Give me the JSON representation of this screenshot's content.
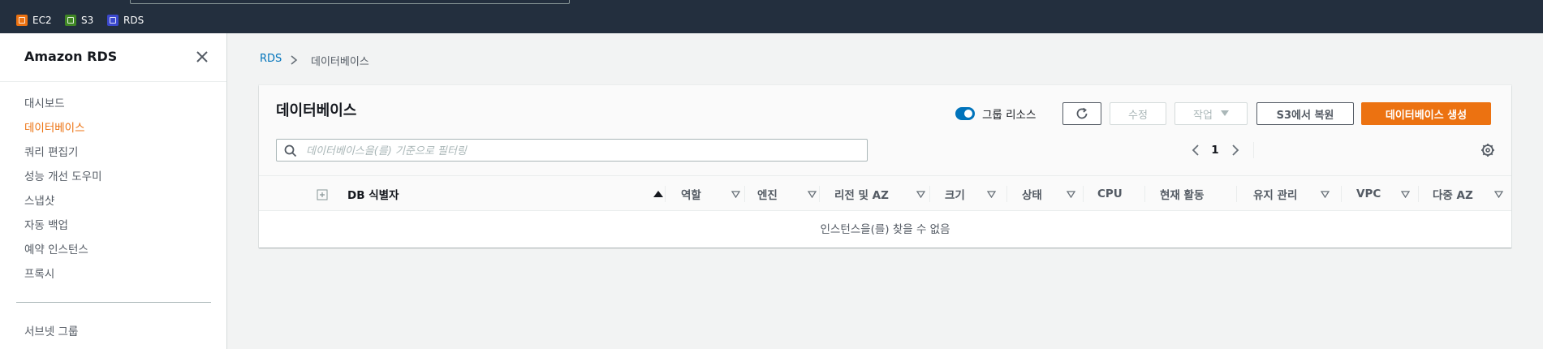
{
  "favorites": [
    {
      "label": "EC2",
      "color": "#ec7211",
      "icon": "ec2-icon"
    },
    {
      "label": "S3",
      "color": "#3f8624",
      "icon": "s3-icon"
    },
    {
      "label": "RDS",
      "color": "#3b48cc",
      "icon": "rds-icon"
    }
  ],
  "sidebar": {
    "title": "Amazon RDS",
    "items": [
      {
        "label": "대시보드"
      },
      {
        "label": "데이터베이스",
        "active": true
      },
      {
        "label": "쿼리 편집기"
      },
      {
        "label": "성능 개선 도우미"
      },
      {
        "label": "스냅샷"
      },
      {
        "label": "자동 백업"
      },
      {
        "label": "예약 인스턴스"
      },
      {
        "label": "프록시"
      }
    ],
    "bottom_items": [
      {
        "label": "서브넷 그룹"
      }
    ]
  },
  "breadcrumb": {
    "root": "RDS",
    "current": "데이터베이스"
  },
  "panel": {
    "title": "데이터베이스",
    "group_toggle_label": "그룹 리소스",
    "group_toggle_on": true,
    "modify_label": "수정",
    "actions_label": "작업",
    "restore_label": "S3에서 복원",
    "create_label": "데이터베이스 생성",
    "filter_placeholder": "데이터베이스을(를) 기준으로 필터링",
    "page_number": "1",
    "columns": [
      {
        "label": "DB 식별자",
        "sort": "asc"
      },
      {
        "label": "역할"
      },
      {
        "label": "엔진"
      },
      {
        "label": "리전 및 AZ"
      },
      {
        "label": "크기"
      },
      {
        "label": "상태"
      },
      {
        "label": "CPU"
      },
      {
        "label": "현재 활동"
      },
      {
        "label": "유지 관리"
      },
      {
        "label": "VPC"
      },
      {
        "label": "다중 AZ"
      }
    ],
    "empty_text": "인스턴스을(를) 찾을 수 없음"
  },
  "colors": {
    "accent": "#ec7211",
    "link": "#0073bb",
    "toggle": "#0073bb",
    "topbar": "#232f3e"
  }
}
